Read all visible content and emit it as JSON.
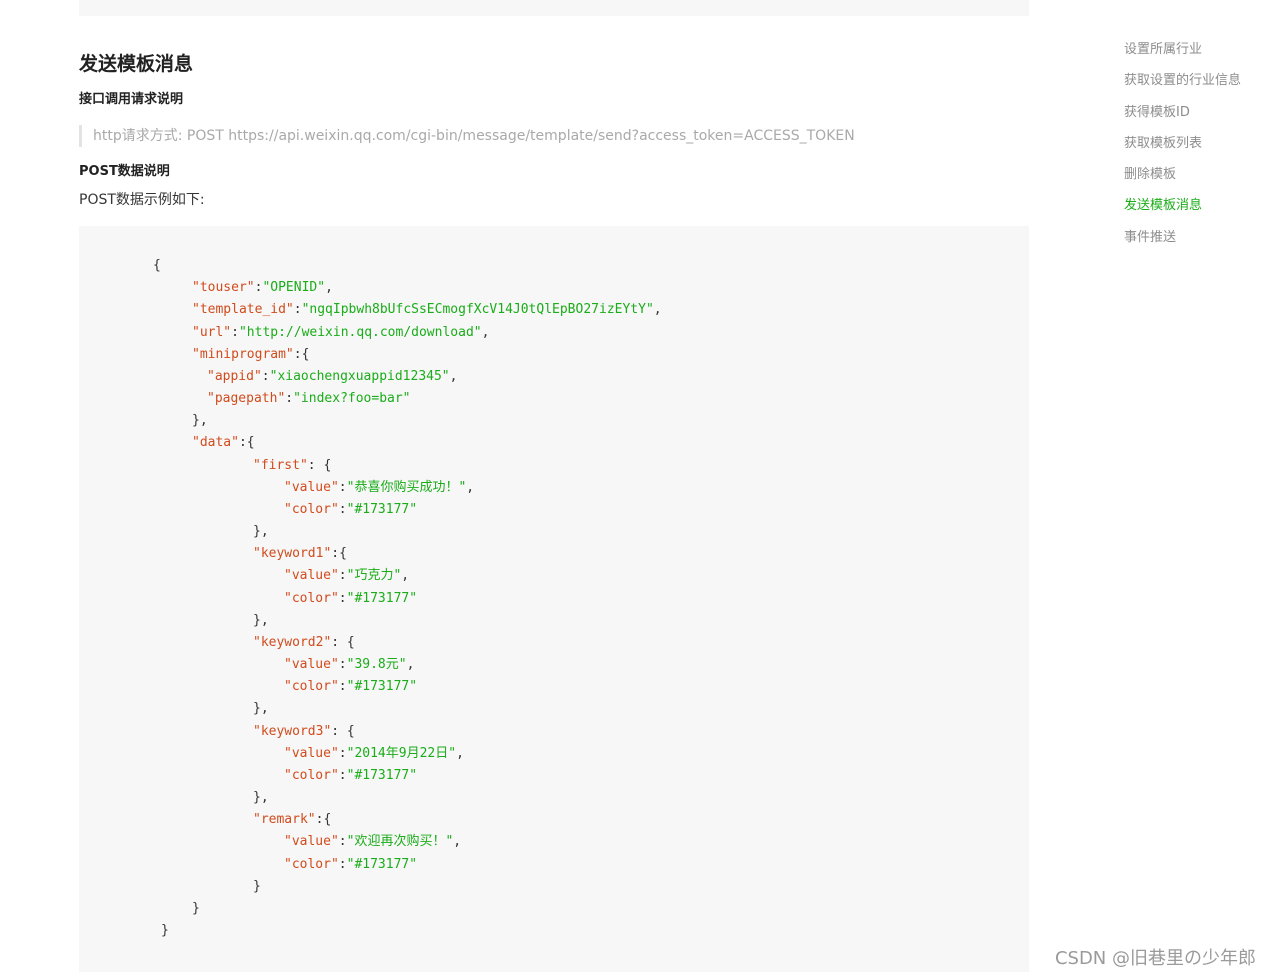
{
  "section": {
    "title": "发送模板消息",
    "request_heading": "接口调用请求说明",
    "request_line": "http请求方式: POST https://api.weixin.qq.com/cgi-bin/message/template/send?access_token=ACCESS_TOKEN",
    "post_heading": "POST数据说明",
    "post_desc": "POST数据示例如下:"
  },
  "code_lines": [
    [
      {
        "t": "{",
        "c": "p"
      }
    ],
    [
      {
        "t": "\"touser\"",
        "c": "k"
      },
      {
        "t": ":",
        "c": "p"
      },
      {
        "t": "\"OPENID\"",
        "c": "s"
      },
      {
        "t": ",",
        "c": "p"
      }
    ],
    [
      {
        "t": "\"template_id\"",
        "c": "k"
      },
      {
        "t": ":",
        "c": "p"
      },
      {
        "t": "\"ngqIpbwh8bUfcSsECmogfXcV14J0tQlEpBO27izEYtY\"",
        "c": "s"
      },
      {
        "t": ",",
        "c": "p"
      }
    ],
    [
      {
        "t": "\"url\"",
        "c": "k"
      },
      {
        "t": ":",
        "c": "p"
      },
      {
        "t": "\"http://weixin.qq.com/download\"",
        "c": "s"
      },
      {
        "t": ",",
        "c": "p"
      }
    ],
    [
      {
        "t": "\"miniprogram\"",
        "c": "k"
      },
      {
        "t": ":{",
        "c": "p"
      }
    ],
    [
      {
        "t": "\"appid\"",
        "c": "k"
      },
      {
        "t": ":",
        "c": "p"
      },
      {
        "t": "\"xiaochengxuappid12345\"",
        "c": "s"
      },
      {
        "t": ",",
        "c": "p"
      }
    ],
    [
      {
        "t": "\"pagepath\"",
        "c": "k"
      },
      {
        "t": ":",
        "c": "p"
      },
      {
        "t": "\"index?foo=bar\"",
        "c": "s"
      }
    ],
    [
      {
        "t": "},",
        "c": "p"
      }
    ],
    [
      {
        "t": "\"data\"",
        "c": "k"
      },
      {
        "t": ":{",
        "c": "p"
      }
    ],
    [
      {
        "t": "\"first\"",
        "c": "k"
      },
      {
        "t": ": {",
        "c": "p"
      }
    ],
    [
      {
        "t": "\"value\"",
        "c": "k"
      },
      {
        "t": ":",
        "c": "p"
      },
      {
        "t": "\"恭喜你购买成功！\"",
        "c": "s"
      },
      {
        "t": ",",
        "c": "p"
      }
    ],
    [
      {
        "t": "\"color\"",
        "c": "k"
      },
      {
        "t": ":",
        "c": "p"
      },
      {
        "t": "\"#173177\"",
        "c": "s"
      }
    ],
    [
      {
        "t": "},",
        "c": "p"
      }
    ],
    [
      {
        "t": "\"keyword1\"",
        "c": "k"
      },
      {
        "t": ":{",
        "c": "p"
      }
    ],
    [
      {
        "t": "\"value\"",
        "c": "k"
      },
      {
        "t": ":",
        "c": "p"
      },
      {
        "t": "\"巧克力\"",
        "c": "s"
      },
      {
        "t": ",",
        "c": "p"
      }
    ],
    [
      {
        "t": "\"color\"",
        "c": "k"
      },
      {
        "t": ":",
        "c": "p"
      },
      {
        "t": "\"#173177\"",
        "c": "s"
      }
    ],
    [
      {
        "t": "},",
        "c": "p"
      }
    ],
    [
      {
        "t": "\"keyword2\"",
        "c": "k"
      },
      {
        "t": ": {",
        "c": "p"
      }
    ],
    [
      {
        "t": "\"value\"",
        "c": "k"
      },
      {
        "t": ":",
        "c": "p"
      },
      {
        "t": "\"39.8元\"",
        "c": "s"
      },
      {
        "t": ",",
        "c": "p"
      }
    ],
    [
      {
        "t": "\"color\"",
        "c": "k"
      },
      {
        "t": ":",
        "c": "p"
      },
      {
        "t": "\"#173177\"",
        "c": "s"
      }
    ],
    [
      {
        "t": "},",
        "c": "p"
      }
    ],
    [
      {
        "t": "\"keyword3\"",
        "c": "k"
      },
      {
        "t": ": {",
        "c": "p"
      }
    ],
    [
      {
        "t": "\"value\"",
        "c": "k"
      },
      {
        "t": ":",
        "c": "p"
      },
      {
        "t": "\"2014年9月22日\"",
        "c": "s"
      },
      {
        "t": ",",
        "c": "p"
      }
    ],
    [
      {
        "t": "\"color\"",
        "c": "k"
      },
      {
        "t": ":",
        "c": "p"
      },
      {
        "t": "\"#173177\"",
        "c": "s"
      }
    ],
    [
      {
        "t": "},",
        "c": "p"
      }
    ],
    [
      {
        "t": "\"remark\"",
        "c": "k"
      },
      {
        "t": ":{",
        "c": "p"
      }
    ],
    [
      {
        "t": "\"value\"",
        "c": "k"
      },
      {
        "t": ":",
        "c": "p"
      },
      {
        "t": "\"欢迎再次购买！\"",
        "c": "s"
      },
      {
        "t": ",",
        "c": "p"
      }
    ],
    [
      {
        "t": "\"color\"",
        "c": "k"
      },
      {
        "t": ":",
        "c": "p"
      },
      {
        "t": "\"#173177\"",
        "c": "s"
      }
    ],
    [
      {
        "t": "}",
        "c": "p"
      }
    ],
    [
      {
        "t": "}",
        "c": "p"
      }
    ],
    [
      {
        "t": "}",
        "c": "p"
      }
    ]
  ],
  "side_nav": {
    "items": [
      {
        "label": "设置所属行业",
        "active": false
      },
      {
        "label": "获取设置的行业信息",
        "active": false
      },
      {
        "label": "获得模板ID",
        "active": false
      },
      {
        "label": "获取模板列表",
        "active": false
      },
      {
        "label": "删除模板",
        "active": false
      },
      {
        "label": "发送模板消息",
        "active": true
      },
      {
        "label": "事件推送",
        "active": false
      }
    ]
  },
  "watermark": "CSDN @旧巷里の少年郎",
  "colors": {
    "key": "#d14b1d",
    "string": "#1aad19",
    "nav_active": "#1aad19",
    "nav_default": "#8d8d8d",
    "code_bg": "#f7f7f7"
  }
}
